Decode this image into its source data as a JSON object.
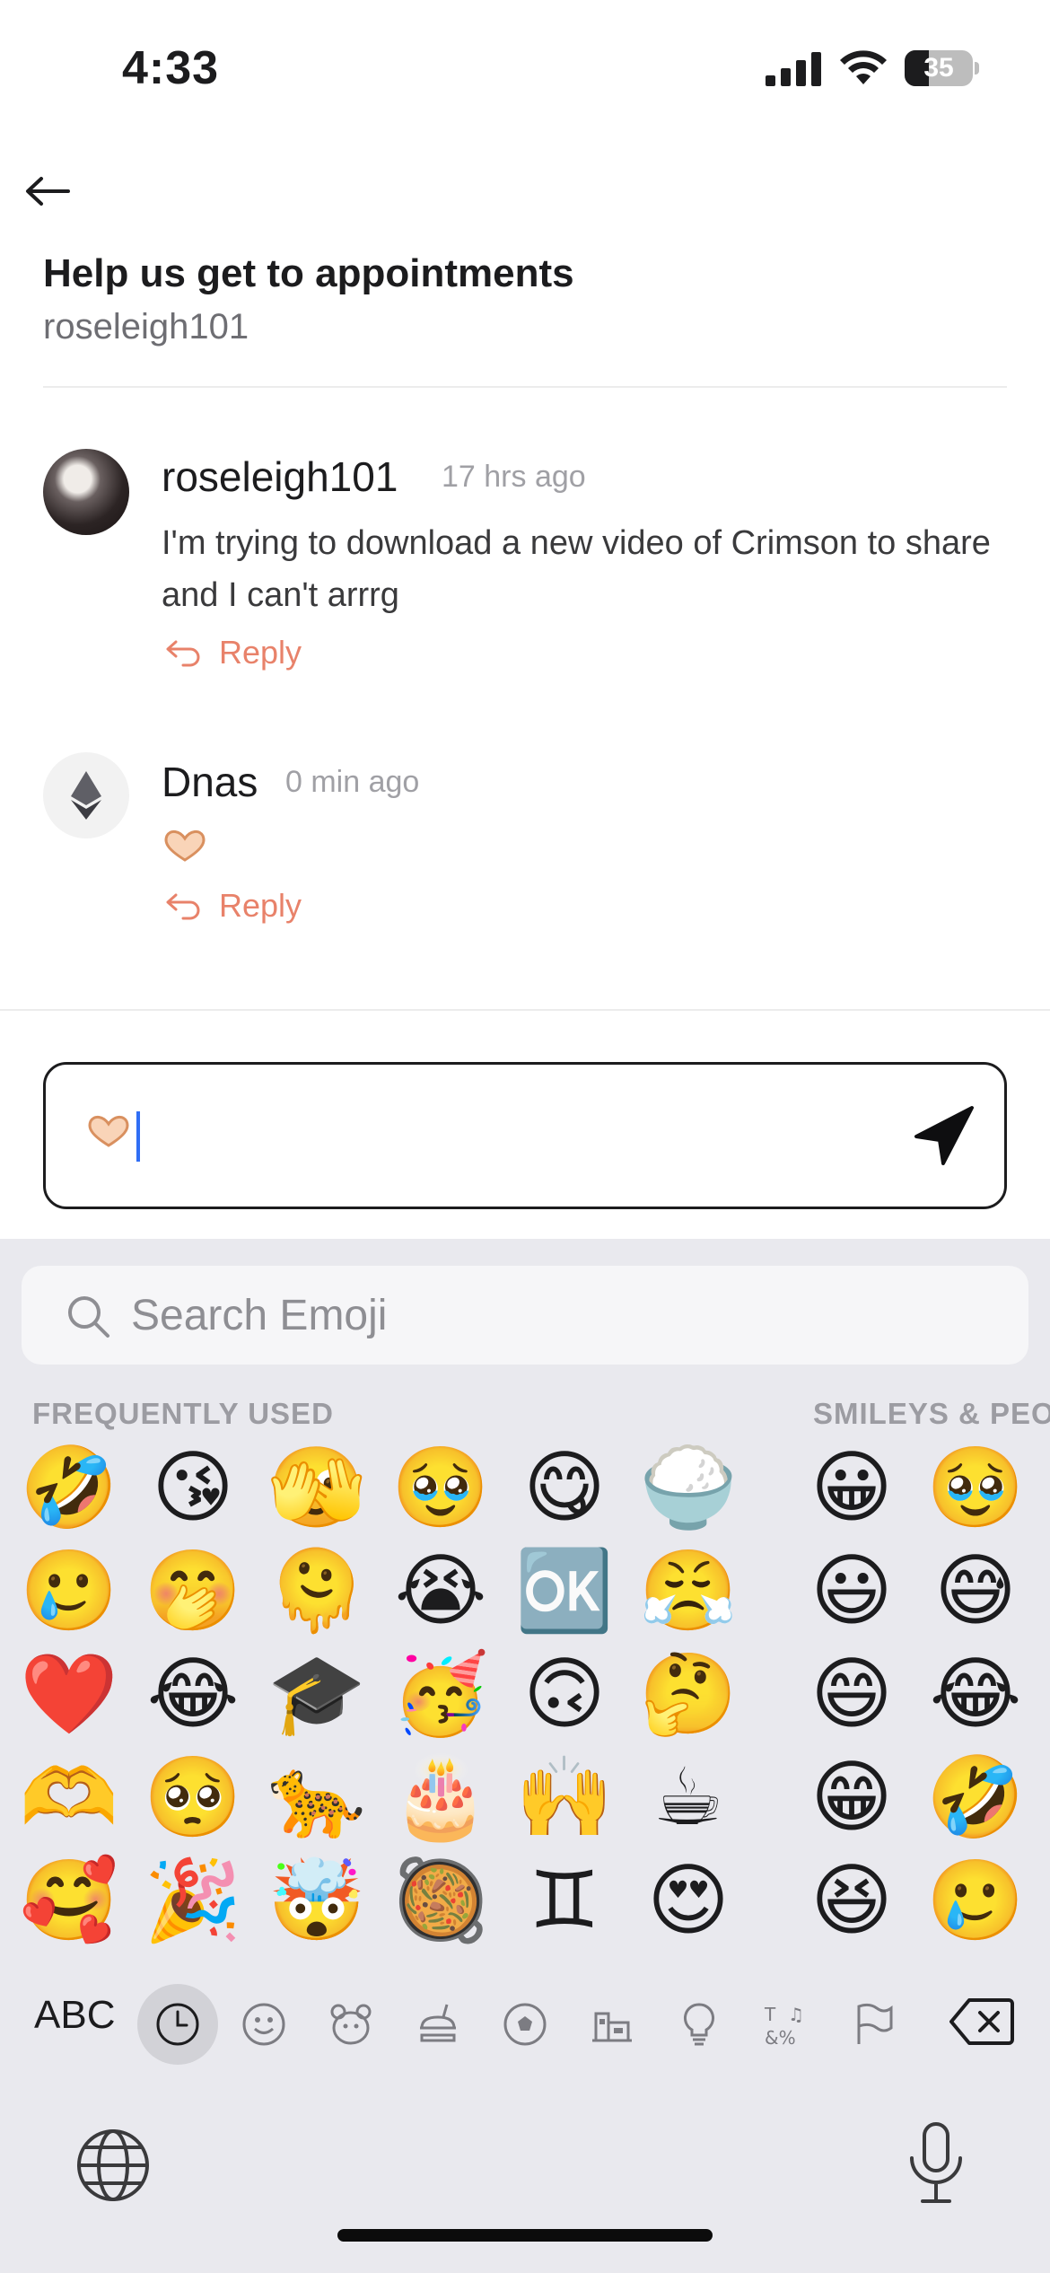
{
  "status_bar": {
    "time": "4:33",
    "battery": "35",
    "battery_level": 0.35
  },
  "header": {
    "back_icon": "back-arrow-icon",
    "title": "Help us get to appointments",
    "author": "roseleigh101"
  },
  "comments": [
    {
      "name": "roseleigh101",
      "time": "17 hrs ago",
      "text": "I'm trying to download a new video of Crimson to share and I can't arrrg",
      "reply_label": "Reply",
      "avatar": "user-photo"
    },
    {
      "name": "Dnas",
      "time": "0 min ago",
      "text": "",
      "emoji": "heart-hands",
      "reply_label": "Reply",
      "avatar": "ethereum-logo"
    }
  ],
  "composer": {
    "value_emoji": "heart-hands",
    "send_icon": "send-icon"
  },
  "keyboard": {
    "search_placeholder": "Search Emoji",
    "sections": {
      "frequently_used": "FREQUENTLY USED",
      "smileys": "SMILEYS & PEO"
    },
    "frequently_used": [
      [
        "🤣",
        "😘",
        "🫣",
        "🥹",
        "😋",
        "🍚"
      ],
      [
        "🥲",
        "🤭",
        "🫠",
        "😭",
        "🆗",
        "😤"
      ],
      [
        "❤️",
        "😂",
        "🎓",
        "🥳",
        "🙃",
        "🤔"
      ],
      [
        "🫶",
        "🥺",
        "🐆",
        "🎂",
        "🙌",
        "☕"
      ],
      [
        "🥰",
        "🎉",
        "🤯",
        "🥘",
        "♊",
        "😍"
      ]
    ],
    "smileys": [
      [
        "😀",
        "🥹"
      ],
      [
        "😃",
        "😅"
      ],
      [
        "😄",
        "😂"
      ],
      [
        "😁",
        "🤣"
      ],
      [
        "😆",
        "🥲"
      ]
    ],
    "abc_label": "ABC",
    "tabs": [
      "recent-icon",
      "smiley-icon",
      "animal-icon",
      "food-icon",
      "activity-icon",
      "travel-icon",
      "objects-icon",
      "symbols-icon",
      "flags-icon"
    ],
    "delete_icon": "delete-icon",
    "globe_icon": "globe-icon",
    "mic_icon": "microphone-icon"
  }
}
